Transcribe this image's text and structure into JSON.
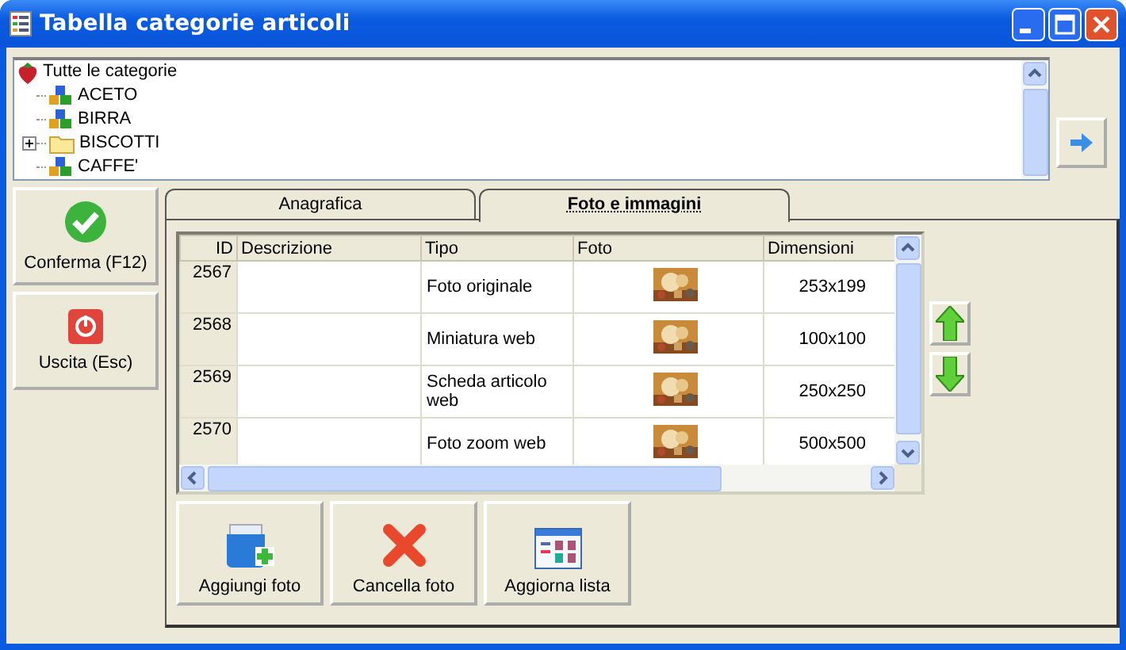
{
  "window": {
    "title": "Tabella categorie articoli"
  },
  "tree": {
    "label": "Tutte le categorie",
    "children": [
      {
        "label": "ACETO",
        "kind": "category"
      },
      {
        "label": "BIRRA",
        "kind": "category"
      },
      {
        "label": "BISCOTTI",
        "kind": "folder",
        "expanded": false
      },
      {
        "label": "CAFFE'",
        "kind": "category"
      }
    ]
  },
  "side_buttons": [
    {
      "label": "Conferma (F12)",
      "kind": "confirm"
    },
    {
      "label": "Uscita (Esc)",
      "kind": "exit"
    }
  ],
  "tabs": [
    {
      "label": "Anagrafica",
      "selected": false
    },
    {
      "label": "Foto e immagini",
      "selected": true
    }
  ],
  "table": {
    "columns": [
      "ID",
      "Descrizione",
      "Tipo",
      "Foto",
      "Dimensioni"
    ],
    "rows": [
      {
        "id": "2567",
        "tipo": "Foto originale",
        "dimensioni": "253x199"
      },
      {
        "id": "2568",
        "tipo": "Miniatura web",
        "dimensioni": "100x100"
      },
      {
        "id": "2569",
        "tipo": "Scheda articolo web",
        "dimensioni": "250x250"
      },
      {
        "id": "2570",
        "tipo": "Foto zoom web",
        "dimensioni": "500x500"
      }
    ]
  },
  "toolbar": [
    {
      "label": "Aggiungi foto",
      "kind": "add"
    },
    {
      "label": "Cancella foto",
      "kind": "delete"
    },
    {
      "label": "Aggiorna lista",
      "kind": "refresh"
    }
  ]
}
